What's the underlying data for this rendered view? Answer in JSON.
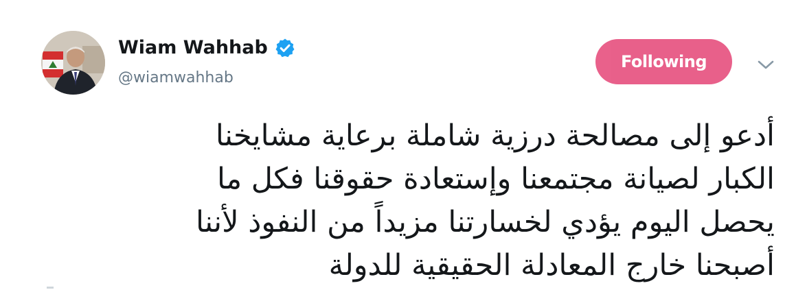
{
  "author": {
    "display_name": "Wiam Wahhab",
    "handle": "@wiamwahhab",
    "verified": true,
    "avatar": "profile-photo"
  },
  "actions": {
    "follow_label": "Following",
    "follow_color": "#e0245e",
    "menu_icon": "chevron-down-icon"
  },
  "tweet": {
    "lines": [
      "أدعو إلى مصالحة درزية شاملة برعاية مشايخنا",
      "الكبار لصيانة مجتمعنا وإستعادة حقوقنا فكل ما",
      "يحصل اليوم يؤدي لخسارتنا مزيداً من النفوذ لأننا",
      "أصبحنا خارج المعادلة الحقيقية للدولة"
    ]
  },
  "colors": {
    "verified_blue": "#1da1f2",
    "text": "#14171a",
    "secondary_text": "#657786"
  }
}
